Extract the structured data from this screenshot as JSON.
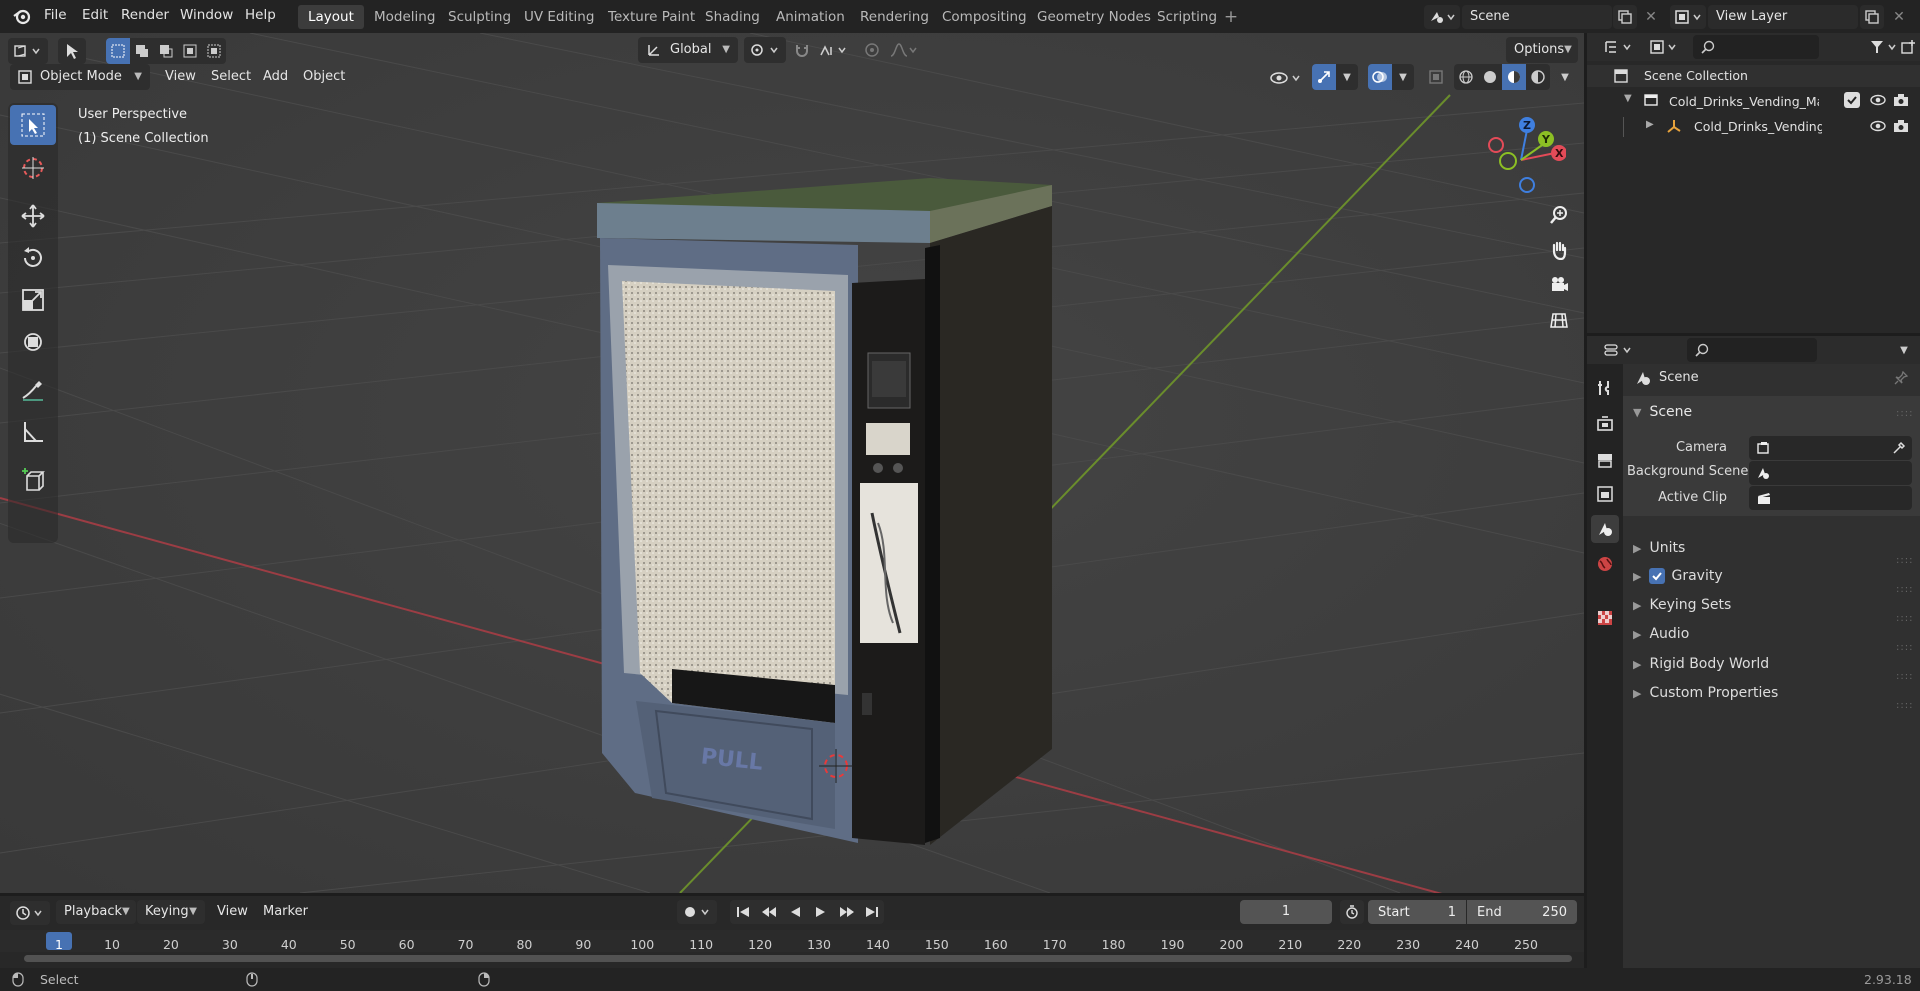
{
  "topbar": {
    "menus": [
      "File",
      "Edit",
      "Render",
      "Window",
      "Help"
    ],
    "workspaces": [
      "Layout",
      "Modeling",
      "Sculpting",
      "UV Editing",
      "Texture Paint",
      "Shading",
      "Animation",
      "Rendering",
      "Compositing",
      "Geometry Nodes",
      "Scripting"
    ],
    "active_workspace": "Layout",
    "scene_name": "Scene",
    "view_layer_name": "View Layer"
  },
  "viewport": {
    "mode": "Object Mode",
    "menus": [
      "View",
      "Select",
      "Add",
      "Object"
    ],
    "orientation": "Global",
    "options_label": "Options",
    "overlay_title": "User Perspective",
    "overlay_collection": "(1) Scene Collection",
    "model_label": "PULL"
  },
  "outliner": {
    "root": "Scene Collection",
    "items": [
      {
        "label": "Cold_Drinks_Vending_Machin"
      },
      {
        "label": "Cold_Drinks_Vending_Ma"
      }
    ]
  },
  "properties": {
    "context_title": "Scene",
    "panel_title": "Scene",
    "fields": [
      {
        "label": "Camera",
        "value": ""
      },
      {
        "label": "Background Scene",
        "value": ""
      },
      {
        "label": "Active Clip",
        "value": ""
      }
    ],
    "subpanels": [
      "Units",
      "Gravity",
      "Keying Sets",
      "Audio",
      "Rigid Body World",
      "Custom Properties"
    ],
    "gravity_checked": true
  },
  "timeline": {
    "menus": [
      "Playback",
      "Keying",
      "View",
      "Marker"
    ],
    "current_frame": "1",
    "start_label": "Start",
    "start_value": "1",
    "end_label": "End",
    "end_value": "250",
    "ruler_labels": [
      "1",
      "10",
      "20",
      "30",
      "40",
      "50",
      "60",
      "70",
      "80",
      "90",
      "100",
      "110",
      "120",
      "130",
      "140",
      "150",
      "160",
      "170",
      "180",
      "190",
      "200",
      "210",
      "220",
      "230",
      "240",
      "250"
    ]
  },
  "statusbar": {
    "select_label": "Select",
    "version": "2.93.18"
  },
  "colors": {
    "accent": "#4772b3",
    "x_axis": "#9c3d44",
    "y_axis": "#6a8d2c",
    "gizmo_x": "#e34b58",
    "gizmo_y": "#8cbf24",
    "gizmo_z": "#3f7fdf"
  }
}
